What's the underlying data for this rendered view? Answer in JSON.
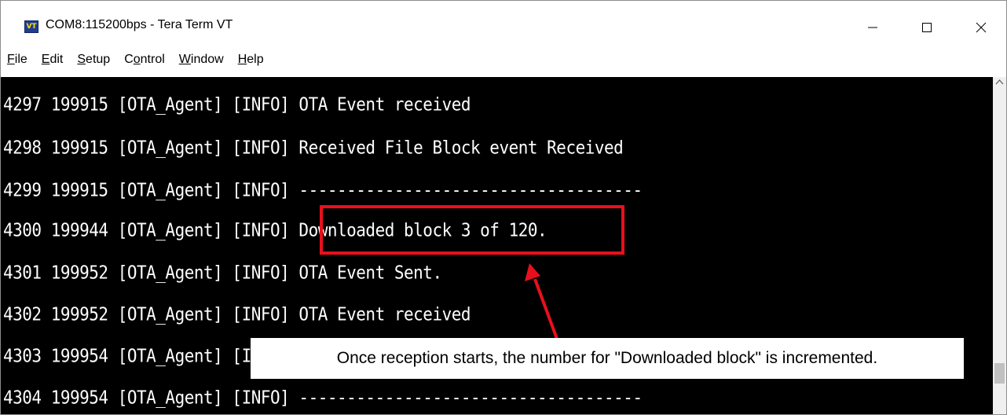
{
  "window": {
    "title": "COM8:115200bps - Tera Term VT",
    "icon_label": "VT",
    "controls": [
      "minimize-icon",
      "maximize-icon",
      "close-icon"
    ]
  },
  "menu": [
    {
      "key": "F",
      "rest": "ile"
    },
    {
      "key": "E",
      "rest": "dit"
    },
    {
      "key": "S",
      "rest": "etup"
    },
    {
      "pre": "C",
      "key": "o",
      "rest": "ntrol"
    },
    {
      "key": "W",
      "rest": "indow"
    },
    {
      "key": "H",
      "rest": "elp"
    }
  ],
  "terminal": {
    "lines": [
      "4297 199915 [OTA_Agent] [INFO] OTA Event received",
      "4298 199915 [OTA_Agent] [INFO] Received File Block event Received",
      "4299 199915 [OTA_Agent] [INFO] ------------------------------------",
      "4300 199944 [OTA_Agent] [INFO] Downloaded block 3 of 120.",
      "4301 199952 [OTA_Agent] [INFO] OTA Event Sent.",
      "4302 199952 [OTA_Agent] [INFO] OTA Event received",
      "4303 199954 [OTA_Agent] [INFO] Received File Block event Received",
      "4304 199954 [OTA_Agent] [INFO] ------------------------------------"
    ]
  },
  "annotation": {
    "callout_text": "Once reception starts, the number for \"Downloaded block\" is incremented.",
    "highlight_color": "#e8101c"
  },
  "colors": {
    "terminal_bg": "#000000",
    "terminal_fg": "#ffffff"
  }
}
